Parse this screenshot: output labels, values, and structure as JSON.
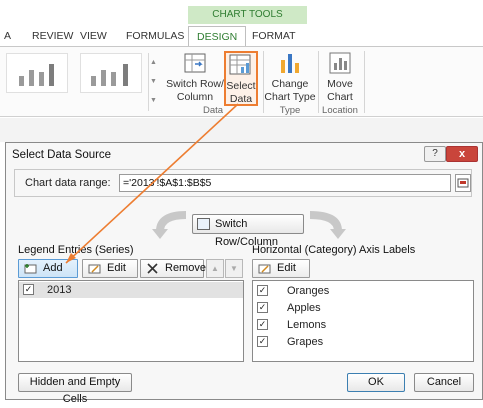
{
  "ribbon": {
    "context_label": "CHART TOOLS",
    "tabs": [
      {
        "label": "A"
      },
      {
        "label": "REVIEW"
      },
      {
        "label": "VIEW"
      },
      {
        "label": "FORMULAS"
      },
      {
        "label": "DESIGN",
        "active": true
      },
      {
        "label": "FORMAT"
      }
    ],
    "buttons": {
      "switch_row_column": [
        "Switch Row/",
        "Column"
      ],
      "select_data": [
        "Select",
        "Data"
      ],
      "change_chart_type": [
        "Change",
        "Chart Type"
      ],
      "move_chart": [
        "Move",
        "Chart"
      ]
    },
    "groups": {
      "data": "Data",
      "type": "Type",
      "location": "Location"
    },
    "accent_color": "#2f7d31",
    "highlight_color": "#ed7d31"
  },
  "dialog": {
    "title": "Select Data Source",
    "help_label": "?",
    "close_label": "x",
    "chart_data_range": {
      "label": "Chart data range:",
      "value": "='2013'!$A$1:$B$5"
    },
    "switch_button": "Switch Row/Column",
    "legend": {
      "label": "Legend Entries (Series)",
      "add": "Add",
      "edit": "Edit",
      "remove": "Remove",
      "up_arrow": "▲",
      "down_arrow": "▼",
      "series": [
        {
          "name": "2013",
          "checked": true
        }
      ]
    },
    "axis": {
      "label": "Horizontal (Category) Axis Labels",
      "edit": "Edit",
      "categories": [
        {
          "name": "Oranges",
          "checked": true
        },
        {
          "name": "Apples",
          "checked": true
        },
        {
          "name": "Lemons",
          "checked": true
        },
        {
          "name": "Grapes",
          "checked": true
        }
      ]
    },
    "hidden_empty": "Hidden and Empty Cells",
    "ok": "OK",
    "cancel": "Cancel"
  }
}
